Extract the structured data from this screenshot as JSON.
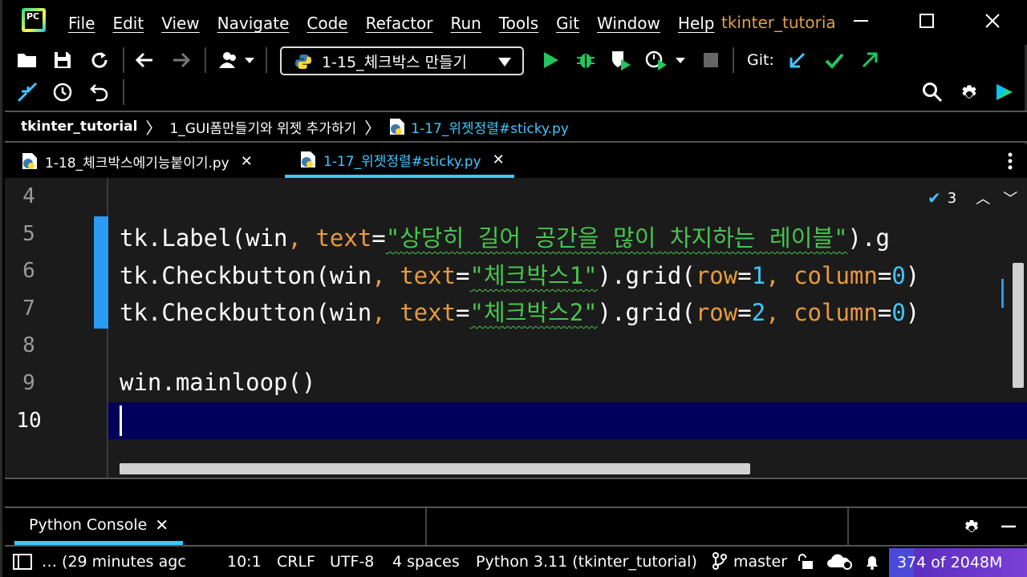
{
  "app": {
    "logo_text": "PC",
    "window_title": "tkinter_tutoria",
    "menu": [
      "File",
      "Edit",
      "View",
      "Navigate",
      "Code",
      "Refactor",
      "Run",
      "Tools",
      "Git",
      "Window",
      "Help"
    ]
  },
  "toolbar": {
    "run_config": "1-15_체크박스 만들기",
    "git_label": "Git:"
  },
  "breadcrumb": {
    "project": "tkinter_tutorial",
    "folder": "1_GUI폼만들기와 위젯 추가하기",
    "file": "1-17_위젯정렬#sticky.py"
  },
  "tabs": [
    {
      "label": "1-18_체크박스에기능붙이기.py",
      "active": false
    },
    {
      "label": "1-17_위젯정렬#sticky.py",
      "active": true
    }
  ],
  "editor": {
    "line_numbers": [
      "4",
      "5",
      "6",
      "7",
      "8",
      "9",
      "10"
    ],
    "inspection_count": "3",
    "lines": {
      "l5": {
        "a": "tk.Label(win",
        "b": ", ",
        "c": "text",
        "d": "=",
        "e": "\"상당히 길어 공간을 많이 차지하는 레이블\"",
        "f": ").g"
      },
      "l6": {
        "a": "tk.Checkbutton(win",
        "b": ", ",
        "c": "text",
        "d": "=",
        "e": "\"체크박스1\"",
        "f": ").grid(",
        "g": "row",
        "h": "=",
        "i": "1",
        "j": ", ",
        "k": "column",
        "l": "=",
        "m": "0",
        "n": ")"
      },
      "l7": {
        "a": "tk.Checkbutton(win",
        "b": ", ",
        "c": "text",
        "d": "=",
        "e": "\"체크박스2\"",
        "f": ").grid(",
        "g": "row",
        "h": "=",
        "i": "2",
        "j": ", ",
        "k": "column",
        "l": "=",
        "m": "0",
        "n": ")"
      },
      "l9": "win.mainloop()"
    }
  },
  "tool_window": {
    "tab_label": "Python Console"
  },
  "status": {
    "message": "… (29 minutes agc",
    "position": "10:1",
    "line_sep": "CRLF",
    "encoding": "UTF-8",
    "indent": "4 spaces",
    "interpreter": "Python 3.11 (tkinter_tutorial)",
    "branch": "master",
    "memory": "374 of 2048M"
  },
  "colors": {
    "accent": "#3fc7ff",
    "keyword": "#e89a3c",
    "string": "#48c44e",
    "current_line": "#00005a",
    "window_title": "#e0a14a"
  }
}
